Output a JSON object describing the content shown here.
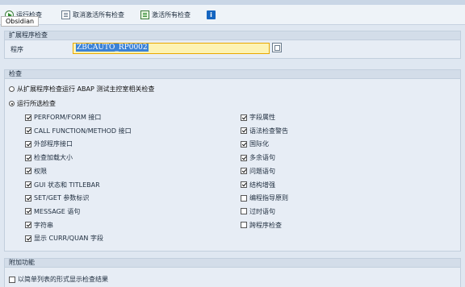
{
  "toolbar": {
    "run_check": "运行检查",
    "cancel_all": "取消激活所有检查",
    "activate_all": "激活所有检查",
    "tooltip": "Obsidian"
  },
  "program_group": {
    "title": "扩展程序检查",
    "program_label": "程序",
    "program_value": "ZBCAUTO_RP0002"
  },
  "checks_group": {
    "title": "检查",
    "radio_tests": "从扩展程序检查运行 ABAP 测试主控室相关检查",
    "radio_selected": "运行所选检查",
    "left_items": [
      {
        "label": "PERFORM/FORM 接口",
        "checked": true
      },
      {
        "label": "CALL FUNCTION/METHOD 接口",
        "checked": true
      },
      {
        "label": "外部程序接口",
        "checked": true
      },
      {
        "label": "检查加载大小",
        "checked": true
      },
      {
        "label": "权限",
        "checked": true
      },
      {
        "label": "GUI 状态和 TITLEBAR",
        "checked": true
      },
      {
        "label": "SET/GET 参数标识",
        "checked": true
      },
      {
        "label": "MESSAGE 语句",
        "checked": true
      },
      {
        "label": "字符串",
        "checked": true
      },
      {
        "label": "显示 CURR/QUAN 字段",
        "checked": true
      }
    ],
    "right_items": [
      {
        "label": "字段属性",
        "checked": true
      },
      {
        "label": "语法检查警告",
        "checked": true
      },
      {
        "label": "国际化",
        "checked": true
      },
      {
        "label": "多余语句",
        "checked": true
      },
      {
        "label": "问题语句",
        "checked": true
      },
      {
        "label": "结构增强",
        "checked": true
      },
      {
        "label": "编程指导原则",
        "checked": false
      },
      {
        "label": "过时语句",
        "checked": false
      },
      {
        "label": "跨程序检查",
        "checked": false
      }
    ]
  },
  "additional_group": {
    "title": "附加功能",
    "simple_list": "以简单列表的形式显示检查结果",
    "simple_list_checked": false
  }
}
